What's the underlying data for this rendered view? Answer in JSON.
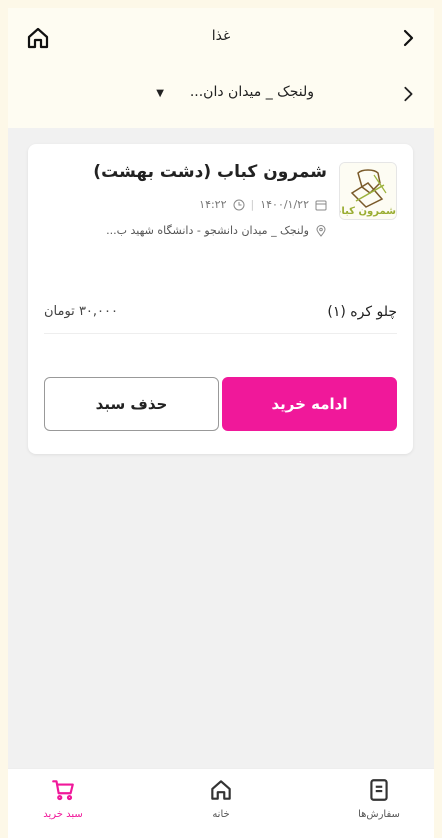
{
  "header": {
    "title": "غذا",
    "location": "ولنجک _ میدان دان..."
  },
  "order": {
    "restaurant_name": "شمرون کباب (دشت بهشت)",
    "logo_text": "شمرون کباب",
    "date": "۱۴۰۰/۱/۲۲",
    "time": "۱۴:۲۲",
    "address": "ولنجک _ میدان دانشجو - دانشگاه شهید ب...",
    "items": [
      {
        "name": "چلو کره (۱)",
        "price": "۳۰,۰۰۰ تومان"
      }
    ],
    "continue_label": "ادامه خرید",
    "delete_label": "حذف سبد"
  },
  "bottom_nav": {
    "cart_label": "سبد خرید",
    "home_label": "خانه",
    "orders_label": "سفارش‌ها"
  },
  "colors": {
    "accent": "#f0189a",
    "background": "#f1f1f1",
    "header_bg": "#fefcf2"
  }
}
